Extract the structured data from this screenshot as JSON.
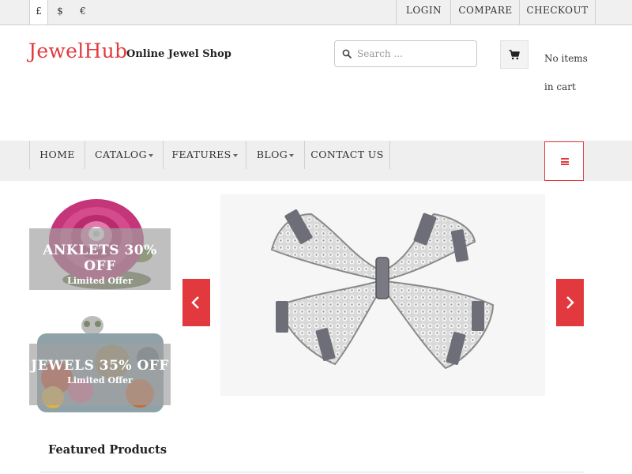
{
  "topbar": {
    "currencies": [
      "£",
      "$",
      "€"
    ],
    "links": [
      "LOGIN",
      "COMPARE",
      "CHECKOUT"
    ]
  },
  "header": {
    "logo": "JewelHub",
    "tagline": "Online Jewel Shop",
    "search": {
      "placeholder": "Search ...",
      "value": ""
    },
    "cart": {
      "icon": "cart-icon",
      "status": "No items in cart"
    }
  },
  "nav": {
    "items": [
      {
        "label": "HOME",
        "dropdown": false
      },
      {
        "label": "CATALOG",
        "dropdown": true
      },
      {
        "label": "FEATURES",
        "dropdown": true
      },
      {
        "label": "BLOG",
        "dropdown": true
      },
      {
        "label": "CONTACT US",
        "dropdown": false
      }
    ],
    "menu_icon": "hamburger-icon"
  },
  "banners": [
    {
      "headline": "ANKLETS 30% OFF",
      "sub": "Limited Offer"
    },
    {
      "headline": "JEWELS 35% OFF",
      "sub": "Limited Offer"
    }
  ],
  "slider": {
    "prev_icon": "chevron-left-icon",
    "next_icon": "chevron-right-icon"
  },
  "sections": {
    "featured_title": "Featured Products"
  },
  "colors": {
    "accent": "#e2393e",
    "topbar_bg": "#f0f0f0",
    "nav_bg": "#efefef"
  }
}
